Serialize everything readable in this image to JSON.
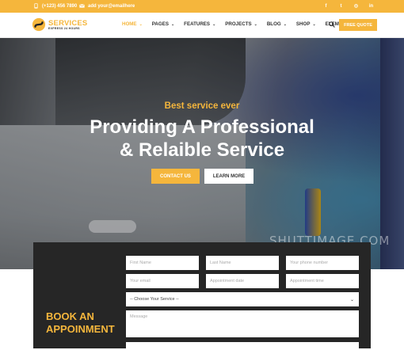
{
  "topbar": {
    "phone": "(+123) 456 7890",
    "email": "add your@emailhere",
    "social": [
      {
        "icon": "facebook-icon",
        "glyph": "f"
      },
      {
        "icon": "twitter-icon",
        "glyph": "t"
      },
      {
        "icon": "instagram-icon",
        "glyph": "◎"
      },
      {
        "icon": "linkedin-icon",
        "glyph": "in"
      }
    ]
  },
  "brand": {
    "name": "SERVICES",
    "tagline": "EXPRESS 24 HOURS",
    "accent_color": "#f5b63c"
  },
  "nav": {
    "items": [
      {
        "label": "HOME",
        "active": true
      },
      {
        "label": "PAGES"
      },
      {
        "label": "FEATURES"
      },
      {
        "label": "PROJECTS"
      },
      {
        "label": "BLOG"
      },
      {
        "label": "SHOP"
      },
      {
        "label": "ELEMENTS"
      }
    ],
    "quote_label": "FREE QUOTE"
  },
  "hero": {
    "subtitle": "Best service ever",
    "title_line1": "Providing A Professional",
    "title_line2": "& Relaible Service",
    "contact_label": "CONTACT US",
    "learn_label": "LEARN MORE",
    "watermark": "SHUTTIMAGE.COM"
  },
  "appointment": {
    "heading_line1": "BOOK AN",
    "heading_line2": "APPOINMENT",
    "first_name": "First Name",
    "last_name": "Last Name",
    "phone": "Your phone number",
    "email": "Your email",
    "date": "Appointment date",
    "time": "Appointment time",
    "service": "-- Choose Your Service --",
    "message": "Message"
  }
}
